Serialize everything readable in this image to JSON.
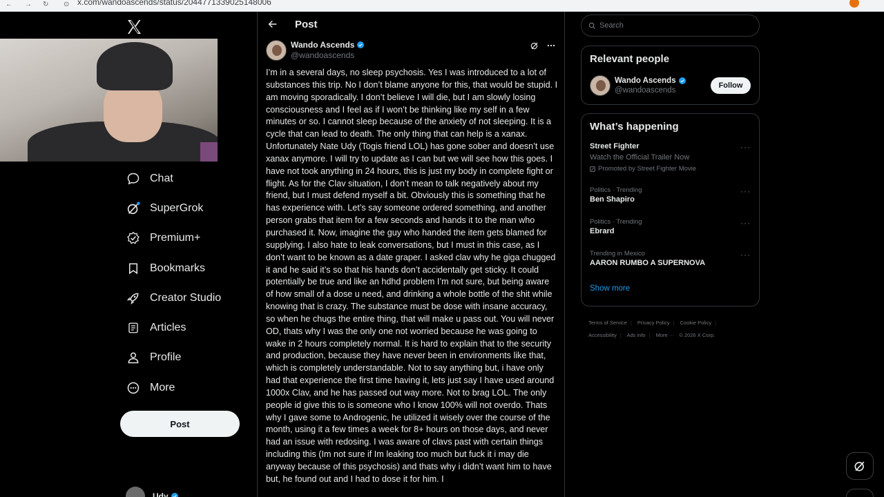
{
  "browser": {
    "url": "x.com/wandoascends/status/2044771339025148006"
  },
  "sidebar": {
    "items": [
      {
        "label": "Chat",
        "icon": "chat-icon"
      },
      {
        "label": "SuperGrok",
        "icon": "grok-icon"
      },
      {
        "label": "Premium+",
        "icon": "premium-icon"
      },
      {
        "label": "Bookmarks",
        "icon": "bookmark-icon"
      },
      {
        "label": "Creator Studio",
        "icon": "rocket-icon"
      },
      {
        "label": "Articles",
        "icon": "articles-icon"
      },
      {
        "label": "Profile",
        "icon": "profile-icon"
      },
      {
        "label": "More",
        "icon": "more-icon"
      }
    ],
    "post_button": "Post",
    "account_name": "Udy"
  },
  "main": {
    "header_title": "Post",
    "author": {
      "name": "Wando Ascends",
      "handle": "@wandoascends"
    },
    "body": "I’m in a several days, no sleep psychosis. Yes I was introduced to a lot of substances this trip. No I don’t blame anyone  for this, that would be stupid. I am moving sporadically. I don’t believe I will die, but I am slowly losing consciousness and I feel as if I won’t be thinking like my self in a few minutes or so. I cannot sleep because of the anxiety of not sleeping. It is a cycle that can lead to death. The only thing that can help is a xanax. Unfortunately Nate Udy (Togis friend LOL) has gone sober and doesn’t use xanax anymore. I will try to update as I can but we will see how this goes. I have not took anything in 24 hours, this is just my body in complete fight or flight. As for the Clav situation, I don’t mean to talk negatively about my friend, but I must defend myself a bit. Obviously this is something that he has experience with. Let’s say someone ordered something, and another person grabs that item for a few seconds and hands it to the man who purchased it. Now, imagine the guy who handed the item gets blamed for supplying. I also hate to leak conversations, but I must in this case, as I don’t want to be known as a date graper. I asked clav why he giga chugged it  and he said it’s so that his hands  don’t accidentally get sticky. It could potentially be true and like an hdhd problem I’m not sure, but being aware of how small of a dose u need, and drinking a whole bottle of the shit while knowing that is crazy. The substance must be dose with insane accuracy, so when he chugs the entire thing, that will make u pass out. You will never OD, thats why I was the only one not worried because he was going to wake in 2 hours completely normal. It is hard to explain that to the security and production, because they have never been in environments like that, which is completely understandable. Not to say anything but, i have only had that experience the first time having it, lets just say I have used around 1000x Clav, and he has passed out way more. Not to brag LOL. The only people id give this to is someone who I know 100% will not overdo. Thats why I gave some to Androgenic, he utilized it wisely over the course of the month, using it a few times a week for 8+ hours on those days, and never had an issue with redosing. I was aware of clavs past with certain things including this (Im not sure if Im leaking too much but fuck it i may die anyway because of this psychosis) and thats why i didn’t want him to have but, he found out and I had to dose it for him. I"
  },
  "right": {
    "search_placeholder": "Search",
    "relevant": {
      "title": "Relevant people",
      "name": "Wando Ascends",
      "handle": "@wandoascends",
      "follow": "Follow"
    },
    "happening": {
      "title": "What’s happening",
      "promo": {
        "name": "Street Fighter",
        "sub": "Watch the Official Trailer Now",
        "promoted": "Promoted by Street Fighter Movie"
      },
      "trends": [
        {
          "meta": "Politics · Trending",
          "name": "Ben Shapiro"
        },
        {
          "meta": "Politics · Trending",
          "name": "Ebrard"
        },
        {
          "meta": "Trending in Mexico",
          "name": "AARON RUMBO A SUPERNOVA"
        }
      ],
      "show_more": "Show more"
    },
    "footer": {
      "links": [
        "Terms of Service",
        "Privacy Policy",
        "Cookie Policy",
        "Accessibility",
        "Ads info",
        "More ···"
      ],
      "copyright": "© 2026 X Corp."
    }
  }
}
